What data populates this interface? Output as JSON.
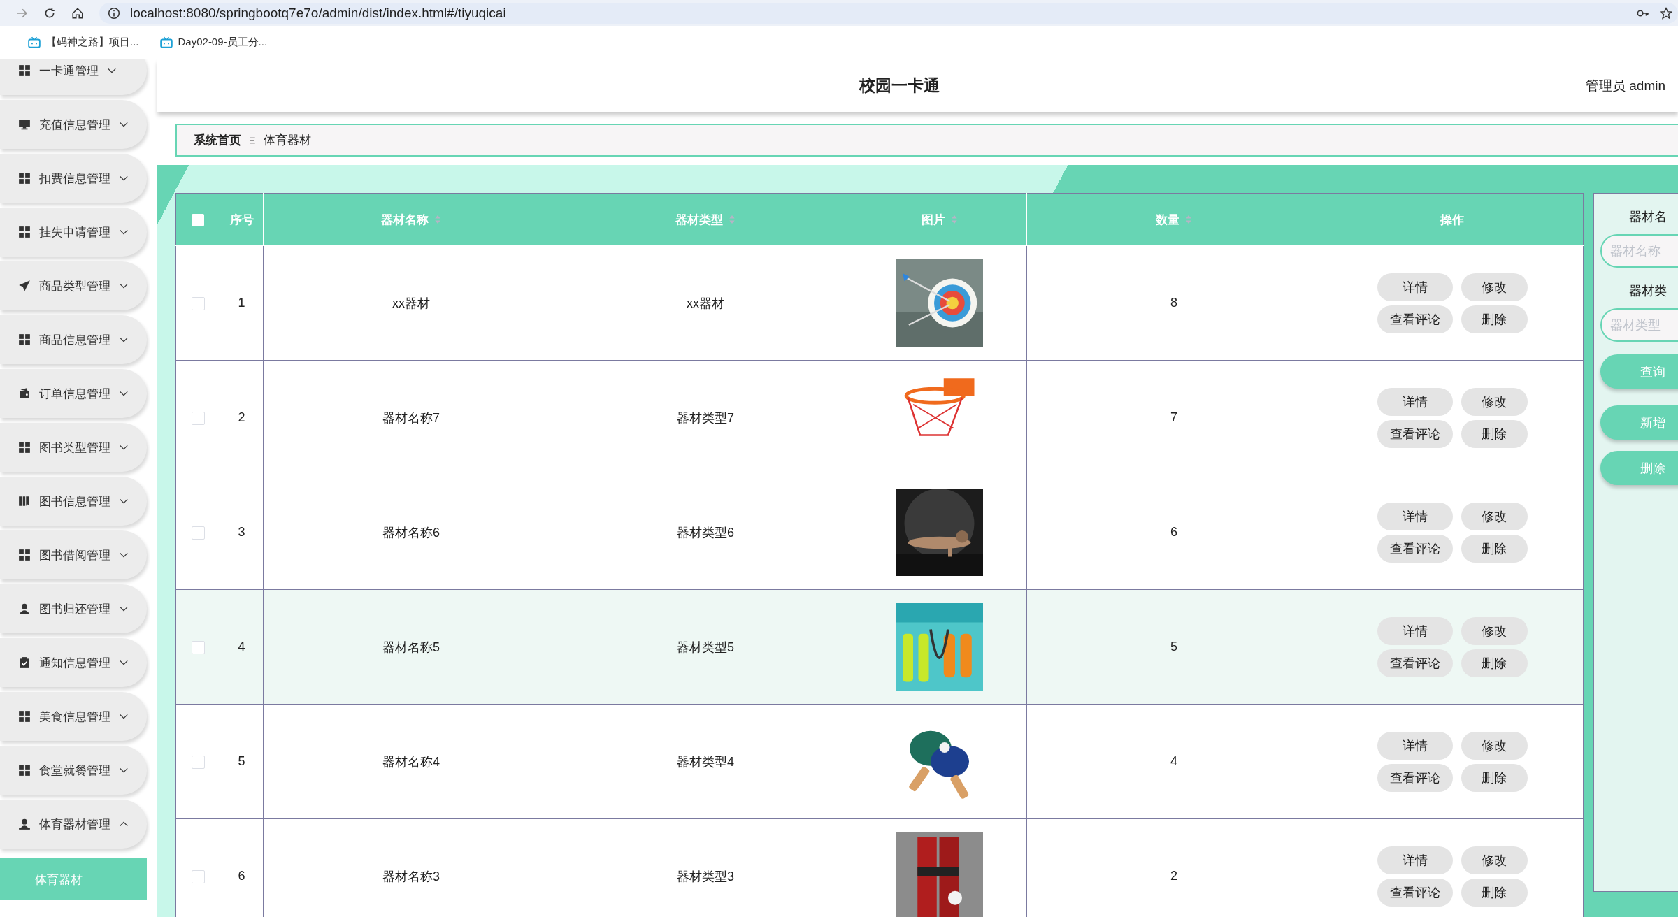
{
  "browser": {
    "address": "localhost:8080/springbootq7e7o/admin/dist/index.html#/tiyuqicai",
    "bookmarks": [
      "【码神之路】项目...",
      "Day02-09-员工分..."
    ]
  },
  "sidebar": {
    "items": [
      {
        "label": "一卡通管理",
        "expanded": false
      },
      {
        "label": "充值信息管理",
        "expanded": false
      },
      {
        "label": "扣费信息管理",
        "expanded": false
      },
      {
        "label": "挂失申请管理",
        "expanded": false
      },
      {
        "label": "商品类型管理",
        "expanded": false
      },
      {
        "label": "商品信息管理",
        "expanded": false
      },
      {
        "label": "订单信息管理",
        "expanded": false
      },
      {
        "label": "图书类型管理",
        "expanded": false
      },
      {
        "label": "图书信息管理",
        "expanded": false
      },
      {
        "label": "图书借阅管理",
        "expanded": false
      },
      {
        "label": "图书归还管理",
        "expanded": false
      },
      {
        "label": "通知信息管理",
        "expanded": false
      },
      {
        "label": "美食信息管理",
        "expanded": false
      },
      {
        "label": "食堂就餐管理",
        "expanded": false
      },
      {
        "label": "体育器材管理",
        "expanded": true,
        "children": [
          {
            "label": "体育器材",
            "selected": true
          }
        ]
      }
    ]
  },
  "header": {
    "title": "校园一卡通",
    "user": "管理员 admin"
  },
  "breadcrumb": [
    "系统首页",
    "体育器材"
  ],
  "table": {
    "all_checked": false,
    "columns": [
      {
        "label": "序号",
        "sortable": false
      },
      {
        "label": "器材名称",
        "sortable": true
      },
      {
        "label": "器材类型",
        "sortable": true
      },
      {
        "label": "图片",
        "sortable": true
      },
      {
        "label": "数量",
        "sortable": true
      },
      {
        "label": "操作",
        "sortable": false
      }
    ],
    "rows": [
      {
        "checked": false,
        "hovered": false,
        "index": "1",
        "name": "xx器材",
        "type": "xx器材",
        "quantity": "8",
        "actions": [
          "详情",
          "修改",
          "查看评论",
          "删除"
        ]
      },
      {
        "checked": false,
        "hovered": false,
        "index": "2",
        "name": "器材名称7",
        "type": "器材类型7",
        "quantity": "7",
        "actions": [
          "详情",
          "修改",
          "查看评论",
          "删除"
        ]
      },
      {
        "checked": false,
        "hovered": false,
        "index": "3",
        "name": "器材名称6",
        "type": "器材类型6",
        "quantity": "6",
        "actions": [
          "详情",
          "修改",
          "查看评论",
          "删除"
        ]
      },
      {
        "checked": false,
        "hovered": true,
        "index": "4",
        "name": "器材名称5",
        "type": "器材类型5",
        "quantity": "5",
        "actions": [
          "详情",
          "修改",
          "查看评论",
          "删除"
        ]
      },
      {
        "checked": false,
        "hovered": false,
        "index": "5",
        "name": "器材名称4",
        "type": "器材类型4",
        "quantity": "4",
        "actions": [
          "详情",
          "修改",
          "查看评论",
          "删除"
        ]
      },
      {
        "checked": false,
        "hovered": false,
        "index": "6",
        "name": "器材名称3",
        "type": "器材类型3",
        "quantity": "2",
        "actions": [
          "详情",
          "修改",
          "查看评论",
          "删除"
        ]
      }
    ]
  },
  "search": {
    "fields": [
      {
        "label": "器材名",
        "placeholder": "器材名称"
      },
      {
        "label": "器材类",
        "placeholder": "器材类型"
      }
    ],
    "buttons": [
      "查询",
      "新增",
      "删除"
    ]
  }
}
